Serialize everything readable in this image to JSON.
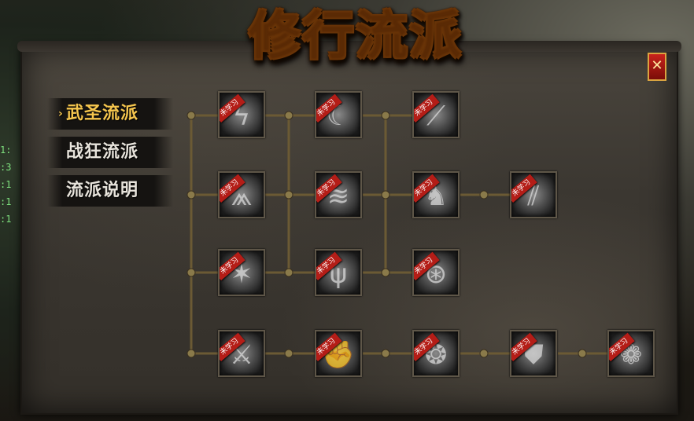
{
  "window": {
    "title": "修行流派",
    "close_label": "✕"
  },
  "nav": {
    "items": [
      {
        "label": "武圣流派",
        "active": true
      },
      {
        "label": "战狂流派",
        "active": false
      },
      {
        "label": "流派说明",
        "active": false
      }
    ],
    "active_marker": "›"
  },
  "skill_status_label": "未学习",
  "skills": [
    {
      "icon": "lightning-skill-icon",
      "glyph": "ϟ",
      "status": "未学习"
    },
    {
      "icon": "crescent-blade-skill-icon",
      "glyph": "☾",
      "status": "未学习"
    },
    {
      "icon": "slash-skill-icon",
      "glyph": "⟋",
      "status": "未学习"
    },
    {
      "icon": "claw-strike-skill-icon",
      "glyph": "⩕",
      "status": "未学习"
    },
    {
      "icon": "whirlwind-skill-icon",
      "glyph": "≋",
      "status": "未学习"
    },
    {
      "icon": "beast-skill-icon",
      "glyph": "♞",
      "status": "未学习"
    },
    {
      "icon": "triple-slash-skill-icon",
      "glyph": "⫽",
      "status": "未学习"
    },
    {
      "icon": "shatter-skill-icon",
      "glyph": "✶",
      "status": "未学习"
    },
    {
      "icon": "rage-skill-icon",
      "glyph": "ψ",
      "status": "未学习"
    },
    {
      "icon": "orb-skill-icon",
      "glyph": "⊛",
      "status": "未学习"
    },
    {
      "icon": "cleave-skill-icon",
      "glyph": "⚔",
      "status": "未学习"
    },
    {
      "icon": "fist-skill-icon",
      "glyph": "✊",
      "status": "未学习"
    },
    {
      "icon": "vortex-skill-icon",
      "glyph": "❂",
      "status": "未学习"
    },
    {
      "icon": "shield-skill-icon",
      "glyph": "⛊",
      "status": "未学习"
    },
    {
      "icon": "flower-skill-icon",
      "glyph": "❁",
      "status": "未学习"
    }
  ]
}
